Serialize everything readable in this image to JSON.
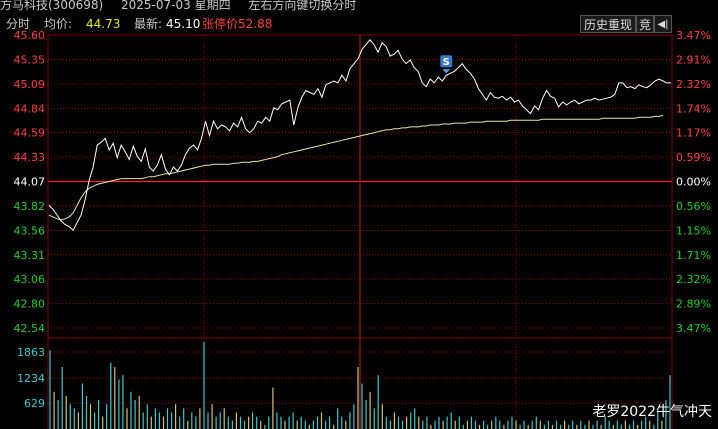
{
  "titlebar": {
    "stock": "方马科技(300698)",
    "date": "2025-07-03 星期四",
    "hint": "左右方向键切换分时"
  },
  "infobar": {
    "mode": "分时",
    "avg_label": "均价:",
    "avg_value": "44.73",
    "last_label": "最新:",
    "last_value": "45.10",
    "limit_label": "张停价:",
    "limit_value": "52.88"
  },
  "toolbar": {
    "history_label": "历史重现",
    "bid_label": "竞",
    "first_icon": "skip-to-start-icon"
  },
  "watermark": "老罗2022牛气冲天",
  "colors": {
    "up": "#ff4040",
    "down": "#20d020",
    "neutral": "#ffffff",
    "price_line": "#ffffff",
    "avg_line": "#e8e8a0",
    "grid": "#8b0000",
    "vol_cyan": "#3fc8c8",
    "vol_gold": "#d8c070",
    "marker": "#3a78c8"
  },
  "chart_data": {
    "type": "line",
    "title": "",
    "prev_close": 44.07,
    "price_ticks": [
      "45.60",
      "45.35",
      "45.09",
      "44.84",
      "44.59",
      "44.33",
      "44.07",
      "43.82",
      "43.56",
      "43.31",
      "43.06",
      "42.80",
      "42.54"
    ],
    "pct_ticks": [
      "3.47%",
      "2.91%",
      "2.32%",
      "1.74%",
      "1.17%",
      "0.59%",
      "0.00%",
      "0.56%",
      "1.15%",
      "1.71%",
      "2.32%",
      "2.89%",
      "3.47%"
    ],
    "volume_ticks": [
      "1863",
      "1234",
      "629"
    ],
    "ylim": [
      42.54,
      45.6
    ],
    "marker_label": "S",
    "series": [
      {
        "values": [
          43.82,
          43.78,
          43.72,
          43.66,
          43.62,
          43.6,
          43.56,
          43.64,
          43.72,
          43.88,
          44.08,
          44.22,
          44.45,
          44.48,
          44.52,
          44.4,
          44.47,
          44.32,
          44.45,
          44.38,
          44.3,
          44.44,
          44.33,
          44.28,
          44.41,
          44.22,
          44.18,
          44.24,
          44.35,
          44.2,
          44.14,
          44.22,
          44.18,
          44.24,
          44.35,
          44.42,
          44.45,
          44.4,
          44.52,
          44.7,
          44.55,
          44.7,
          44.62,
          44.66,
          44.64,
          44.6,
          44.68,
          44.64,
          44.74,
          44.62,
          44.58,
          44.62,
          44.7,
          44.68,
          44.74,
          44.7,
          44.84,
          44.82,
          44.88,
          44.9,
          44.92,
          44.66,
          44.84,
          44.95,
          45.02,
          45.0,
          44.98,
          45.04,
          44.95,
          45.08,
          45.1,
          45.12,
          45.1,
          45.18,
          45.12,
          45.25,
          45.3,
          45.35,
          45.45,
          45.5,
          45.55,
          45.5,
          45.42,
          45.52,
          45.48,
          45.38,
          45.4,
          45.44,
          45.35,
          45.3,
          45.34,
          45.26,
          45.22,
          45.1,
          45.06,
          45.14,
          45.1,
          45.16,
          45.12,
          45.18,
          45.2,
          45.22,
          45.26,
          45.3,
          45.24,
          45.2,
          45.14,
          45.04,
          44.98,
          44.92,
          45.0,
          44.95,
          44.94,
          44.96,
          44.92,
          44.95,
          44.9,
          44.92,
          44.86,
          44.82,
          44.78,
          44.86,
          44.82,
          44.94,
          45.02,
          44.96,
          44.94,
          44.85,
          44.9,
          44.87,
          44.9,
          44.92,
          44.88,
          44.9,
          44.92,
          44.92,
          44.94,
          44.92,
          44.93,
          44.94,
          44.95,
          44.98,
          45.1,
          45.1,
          45.05,
          45.06,
          45.04,
          45.08,
          45.06,
          45.05,
          45.08,
          45.12,
          45.14,
          45.12,
          45.1,
          45.1
        ]
      },
      {
        "values": [
          43.72,
          43.7,
          43.68,
          43.67,
          43.68,
          43.7,
          43.74,
          43.82,
          43.9,
          43.96,
          44.0,
          44.02,
          44.04,
          44.05,
          44.06,
          44.07,
          44.08,
          44.09,
          44.1,
          44.1,
          44.1,
          44.1,
          44.1,
          44.1,
          44.11,
          44.12,
          44.12,
          44.13,
          44.14,
          44.15,
          44.15,
          44.16,
          44.17,
          44.18,
          44.19,
          44.2,
          44.21,
          44.22,
          44.23,
          44.24,
          44.24,
          44.25,
          44.25,
          44.25,
          44.25,
          44.25,
          44.26,
          44.26,
          44.27,
          44.27,
          44.27,
          44.28,
          44.28,
          44.29,
          44.3,
          44.31,
          44.32,
          44.33,
          44.35,
          44.36,
          44.37,
          44.38,
          44.39,
          44.4,
          44.41,
          44.42,
          44.43,
          44.44,
          44.45,
          44.46,
          44.47,
          44.48,
          44.49,
          44.5,
          44.51,
          44.52,
          44.53,
          44.54,
          44.55,
          44.56,
          44.57,
          44.58,
          44.59,
          44.6,
          44.61,
          44.61,
          44.62,
          44.62,
          44.63,
          44.63,
          44.64,
          44.64,
          44.64,
          44.65,
          44.65,
          44.66,
          44.66,
          44.66,
          44.67,
          44.67,
          44.67,
          44.68,
          44.68,
          44.68,
          44.68,
          44.69,
          44.69,
          44.69,
          44.69,
          44.7,
          44.7,
          44.7,
          44.7,
          44.7,
          44.7,
          44.71,
          44.71,
          44.71,
          44.71,
          44.71,
          44.71,
          44.71,
          44.71,
          44.72,
          44.72,
          44.72,
          44.72,
          44.72,
          44.72,
          44.72,
          44.72,
          44.72,
          44.72,
          44.72,
          44.72,
          44.72,
          44.72,
          44.72,
          44.73,
          44.73,
          44.73,
          44.73,
          44.73,
          44.73,
          44.73,
          44.73,
          44.73,
          44.74,
          44.74,
          44.74,
          44.74,
          44.75,
          44.75,
          44.76
        ]
      }
    ],
    "volumes": [
      1900,
      900,
      700,
      1500,
      800,
      600,
      500,
      400,
      1100,
      800,
      600,
      400,
      700,
      300,
      600,
      1600,
      1500,
      1200,
      1300,
      500,
      900,
      700,
      800,
      400,
      600,
      300,
      500,
      400,
      300,
      500,
      400,
      600,
      300,
      500,
      200,
      400,
      300,
      500,
      2100,
      400,
      600,
      300,
      400,
      500,
      300,
      200,
      400,
      300,
      200,
      300,
      400,
      300,
      200,
      100,
      300,
      1000,
      400,
      300,
      200,
      300,
      400,
      200,
      300,
      200,
      100,
      200,
      300,
      400,
      200,
      300,
      100,
      500,
      300,
      200,
      400,
      600,
      1500,
      1100,
      700,
      900,
      500,
      1300,
      600,
      300,
      200,
      400,
      300,
      200,
      300,
      400,
      500,
      300,
      200,
      300,
      100,
      200,
      300,
      200,
      300,
      400,
      200,
      300,
      100,
      200,
      300,
      200,
      100,
      200,
      100,
      200,
      300,
      200,
      100,
      200,
      300,
      200,
      100,
      200,
      100,
      200,
      300,
      200,
      100,
      200,
      100,
      200,
      100,
      200,
      100,
      200,
      100,
      200,
      100,
      200,
      100,
      200,
      100,
      300,
      200,
      100,
      200,
      100,
      200,
      100,
      200,
      100,
      200,
      300,
      200,
      100,
      500,
      200,
      700,
      1300
    ]
  }
}
